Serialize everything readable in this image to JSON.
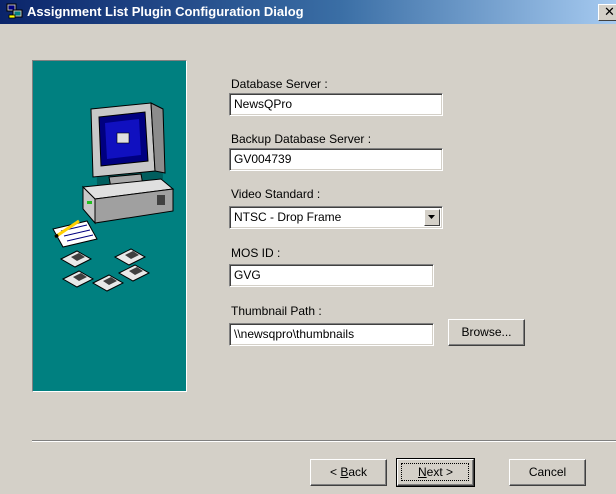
{
  "window": {
    "title": "Assignment List Plugin Configuration Dialog",
    "close_glyph": "✕"
  },
  "form": {
    "database_server": {
      "label": "Database Server :",
      "value": "NewsQPro"
    },
    "backup_database_server": {
      "label": "Backup Database Server :",
      "value": "GV004739"
    },
    "video_standard": {
      "label": "Video Standard :",
      "value": "NTSC - Drop Frame"
    },
    "mos_id": {
      "label": "MOS ID :",
      "value": "GVG"
    },
    "thumbnail_path": {
      "label": "Thumbnail Path :",
      "value": "\\\\newsqpro\\thumbnails",
      "browse_label": "Browse..."
    }
  },
  "buttons": {
    "back": {
      "prefix": "< ",
      "mnemonic": "B",
      "rest": "ack"
    },
    "next": {
      "mnemonic": "N",
      "rest": "ext >"
    },
    "cancel": "Cancel"
  },
  "icons": [
    "dialog-app-icon",
    "computer-icon",
    "notepad-icon",
    "floppy-disk-icon",
    "close-icon",
    "dropdown-arrow-icon"
  ],
  "colors": {
    "titlebar_start": "#0a246a",
    "titlebar_end": "#a6caf0",
    "art_panel": "#008080",
    "dialog_face": "#d4d0c8"
  }
}
